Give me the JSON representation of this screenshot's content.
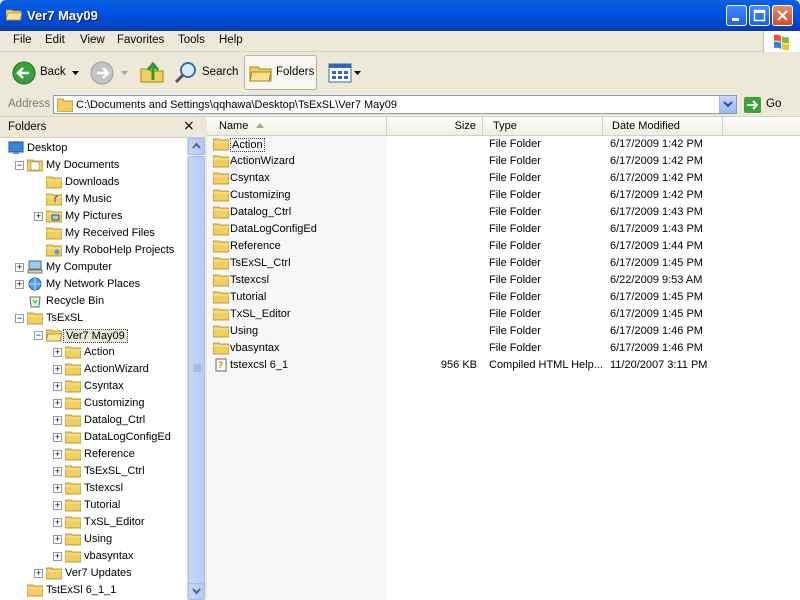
{
  "window": {
    "title": "Ver7 May09"
  },
  "menu": [
    "File",
    "Edit",
    "View",
    "Favorites",
    "Tools",
    "Help"
  ],
  "toolbar": {
    "back": "Back",
    "search": "Search",
    "folders": "Folders"
  },
  "address": {
    "label": "Address",
    "path": "C:\\Documents and Settings\\qqhawa\\Desktop\\TsExSL\\Ver7 May09",
    "go": "Go"
  },
  "folders_pane": {
    "title": "Folders",
    "close": "×",
    "tree": [
      {
        "label": "Desktop",
        "level": 0,
        "expander": "",
        "icon": "desktop-icon"
      },
      {
        "label": "My Documents",
        "level": 1,
        "expander": "−",
        "icon": "my-documents-icon"
      },
      {
        "label": "Downloads",
        "level": 2,
        "expander": "",
        "icon": "folder-icon"
      },
      {
        "label": "My Music",
        "level": 2,
        "expander": "",
        "icon": "music-folder-icon"
      },
      {
        "label": "My Pictures",
        "level": 2,
        "expander": "+",
        "icon": "pictures-folder-icon"
      },
      {
        "label": "My Received Files",
        "level": 2,
        "expander": "",
        "icon": "folder-icon"
      },
      {
        "label": "My RoboHelp Projects",
        "level": 2,
        "expander": "",
        "icon": "robohelp-folder-icon"
      },
      {
        "label": "My Computer",
        "level": 1,
        "expander": "+",
        "icon": "my-computer-icon"
      },
      {
        "label": "My Network Places",
        "level": 1,
        "expander": "+",
        "icon": "network-places-icon"
      },
      {
        "label": "Recycle Bin",
        "level": 1,
        "expander": "",
        "icon": "recycle-bin-icon"
      },
      {
        "label": "TsExSL",
        "level": 1,
        "expander": "−",
        "icon": "folder-icon"
      },
      {
        "label": "Ver7 May09",
        "level": 2,
        "expander": "−",
        "icon": "open-folder-icon",
        "selected": true
      },
      {
        "label": "Action",
        "level": 3,
        "expander": "+",
        "icon": "folder-icon"
      },
      {
        "label": "ActionWizard",
        "level": 3,
        "expander": "+",
        "icon": "folder-icon"
      },
      {
        "label": "Csyntax",
        "level": 3,
        "expander": "+",
        "icon": "folder-icon"
      },
      {
        "label": "Customizing",
        "level": 3,
        "expander": "+",
        "icon": "folder-icon"
      },
      {
        "label": "Datalog_Ctrl",
        "level": 3,
        "expander": "+",
        "icon": "folder-icon"
      },
      {
        "label": "DataLogConfigEd",
        "level": 3,
        "expander": "+",
        "icon": "folder-icon"
      },
      {
        "label": "Reference",
        "level": 3,
        "expander": "+",
        "icon": "folder-icon"
      },
      {
        "label": "TsExSL_Ctrl",
        "level": 3,
        "expander": "+",
        "icon": "folder-icon"
      },
      {
        "label": "Tstexcsl",
        "level": 3,
        "expander": "+",
        "icon": "folder-icon"
      },
      {
        "label": "Tutorial",
        "level": 3,
        "expander": "+",
        "icon": "folder-icon"
      },
      {
        "label": "TxSL_Editor",
        "level": 3,
        "expander": "+",
        "icon": "folder-icon"
      },
      {
        "label": "Using",
        "level": 3,
        "expander": "+",
        "icon": "folder-icon"
      },
      {
        "label": "vbasyntax",
        "level": 3,
        "expander": "+",
        "icon": "folder-icon"
      },
      {
        "label": "Ver7 Updates",
        "level": 2,
        "expander": "+",
        "icon": "folder-icon"
      },
      {
        "label": "TstExSl 6_1_1",
        "level": 1,
        "expander": "",
        "icon": "folder-icon"
      }
    ]
  },
  "list": {
    "columns": {
      "name": "Name",
      "size": "Size",
      "type": "Type",
      "date": "Date Modified"
    },
    "rows": [
      {
        "name": "Action",
        "size": "",
        "type": "File Folder",
        "date": "6/17/2009 1:42 PM",
        "icon": "folder-icon",
        "selected": true
      },
      {
        "name": "ActionWizard",
        "size": "",
        "type": "File Folder",
        "date": "6/17/2009 1:42 PM",
        "icon": "folder-icon"
      },
      {
        "name": "Csyntax",
        "size": "",
        "type": "File Folder",
        "date": "6/17/2009 1:42 PM",
        "icon": "folder-icon"
      },
      {
        "name": "Customizing",
        "size": "",
        "type": "File Folder",
        "date": "6/17/2009 1:42 PM",
        "icon": "folder-icon"
      },
      {
        "name": "Datalog_Ctrl",
        "size": "",
        "type": "File Folder",
        "date": "6/17/2009 1:43 PM",
        "icon": "folder-icon"
      },
      {
        "name": "DataLogConfigEd",
        "size": "",
        "type": "File Folder",
        "date": "6/17/2009 1:43 PM",
        "icon": "folder-icon"
      },
      {
        "name": "Reference",
        "size": "",
        "type": "File Folder",
        "date": "6/17/2009 1:44 PM",
        "icon": "folder-icon"
      },
      {
        "name": "TsExSL_Ctrl",
        "size": "",
        "type": "File Folder",
        "date": "6/17/2009 1:45 PM",
        "icon": "folder-icon"
      },
      {
        "name": "Tstexcsl",
        "size": "",
        "type": "File Folder",
        "date": "6/22/2009 9:53 AM",
        "icon": "folder-icon"
      },
      {
        "name": "Tutorial",
        "size": "",
        "type": "File Folder",
        "date": "6/17/2009 1:45 PM",
        "icon": "folder-icon"
      },
      {
        "name": "TxSL_Editor",
        "size": "",
        "type": "File Folder",
        "date": "6/17/2009 1:45 PM",
        "icon": "folder-icon"
      },
      {
        "name": "Using",
        "size": "",
        "type": "File Folder",
        "date": "6/17/2009 1:46 PM",
        "icon": "folder-icon"
      },
      {
        "name": "vbasyntax",
        "size": "",
        "type": "File Folder",
        "date": "6/17/2009 1:46 PM",
        "icon": "folder-icon"
      },
      {
        "name": "tstexcsl 6_1",
        "size": "956 KB",
        "type": "Compiled HTML Help...",
        "date": "11/20/2007 3:11 PM",
        "icon": "chm-file-icon"
      }
    ]
  }
}
